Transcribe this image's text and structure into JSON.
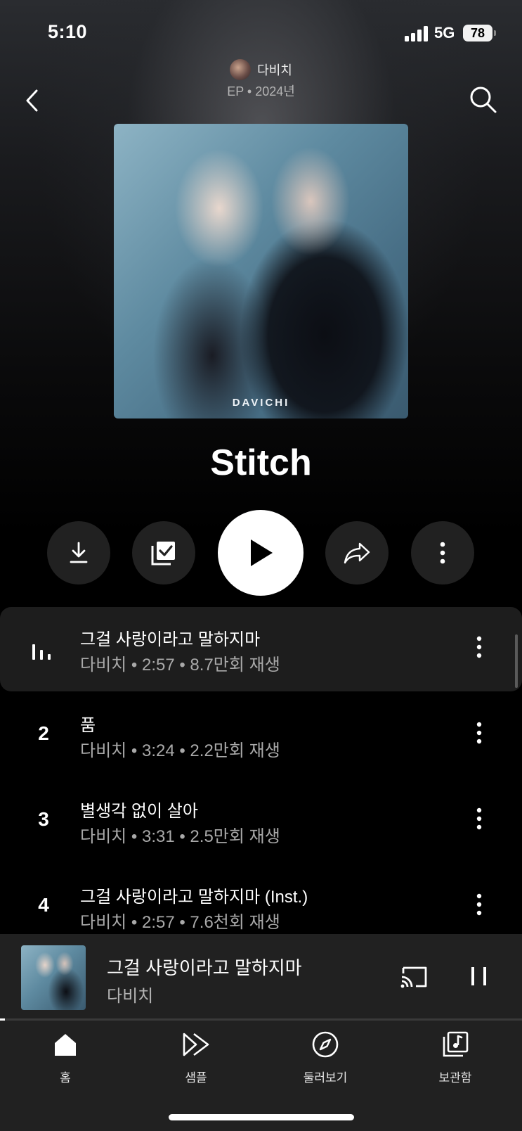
{
  "status_bar": {
    "time": "5:10",
    "network": "5G",
    "battery": "78"
  },
  "header": {
    "artist": "다비치",
    "meta": "EP • 2024년",
    "back_icon": "chevron-left-icon",
    "search_icon": "search-icon"
  },
  "album": {
    "cover_text": "DAVICHI",
    "title": "Stitch"
  },
  "actions": [
    {
      "name": "download-button",
      "icon": "download-icon"
    },
    {
      "name": "save-to-library-button",
      "icon": "library-check-icon"
    },
    {
      "name": "play-button",
      "icon": "play-icon"
    },
    {
      "name": "share-button",
      "icon": "share-icon"
    },
    {
      "name": "more-button",
      "icon": "more-vert-icon"
    }
  ],
  "tracks": [
    {
      "number": "",
      "playing": true,
      "title": "그걸 사랑이라고 말하지마",
      "subtitle": "다비치 • 2:57 • 8.7만회 재생"
    },
    {
      "number": "2",
      "playing": false,
      "title": "품",
      "subtitle": "다비치 • 3:24 • 2.2만회 재생"
    },
    {
      "number": "3",
      "playing": false,
      "title": "별생각 없이 살아",
      "subtitle": "다비치 • 3:31 • 2.5만회 재생"
    },
    {
      "number": "4",
      "playing": false,
      "title": "그걸 사랑이라고 말하지마 (Inst.)",
      "subtitle": "다비치 • 2:57 • 7.6천회 재생"
    }
  ],
  "mini_player": {
    "title": "그걸 사랑이라고 말하지마",
    "artist": "다비치",
    "progress": 0.01
  },
  "nav": [
    {
      "label": "홈",
      "icon": "home-icon",
      "active": true
    },
    {
      "label": "샘플",
      "icon": "samples-icon",
      "active": false
    },
    {
      "label": "둘러보기",
      "icon": "explore-icon",
      "active": false
    },
    {
      "label": "보관함",
      "icon": "library-icon",
      "active": false
    }
  ],
  "colors": {
    "background": "#000000",
    "surface": "#212121",
    "text_secondary": "#a9a9a9"
  }
}
